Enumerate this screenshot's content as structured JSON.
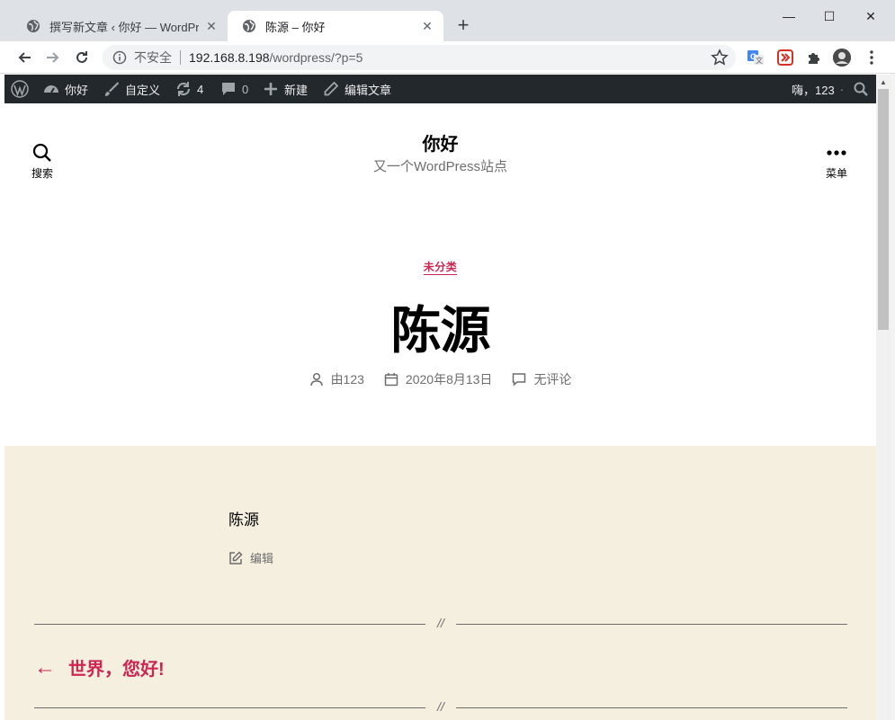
{
  "browser": {
    "tabs": [
      {
        "title": "撰写新文章 ‹ 你好 — WordPress",
        "close": "✕"
      },
      {
        "title": "陈源 – 你好",
        "close": "✕"
      }
    ],
    "new_tab": "+",
    "window_controls": {
      "minimize": "—",
      "maximize": "☐",
      "close": "✕"
    },
    "address": {
      "security": "不安全",
      "host": "192.168.8.198",
      "path": "/wordpress/?p=5"
    }
  },
  "admin_bar": {
    "site_name": "你好",
    "customize": "自定义",
    "updates_count": "4",
    "comments_count": "0",
    "new": "新建",
    "edit_post": "编辑文章",
    "greeting": "嗨，123"
  },
  "header": {
    "search_label": "搜索",
    "site_title": "你好",
    "site_description": "又一个WordPress站点",
    "menu_label": "菜单"
  },
  "post": {
    "category": "未分类",
    "title": "陈源",
    "author": "由123",
    "date": "2020年8月13日",
    "comments": "无评论",
    "content": "陈源",
    "edit": "编辑",
    "divider_mark": "//"
  },
  "navigation": {
    "prev_arrow": "←",
    "prev_title": "世界，您好!"
  },
  "colors": {
    "accent": "#cd2653",
    "admin_bar": "#23282d",
    "content_bg": "#f5efe0",
    "tab_strip": "#dee1e6"
  }
}
